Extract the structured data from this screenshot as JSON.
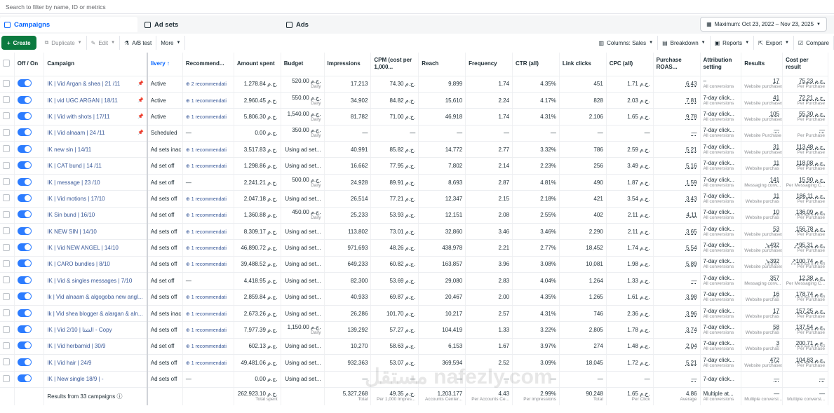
{
  "search": {
    "placeholder": "Search to filter by name, ID or metrics"
  },
  "tabs": {
    "campaigns": "Campaigns",
    "adsets": "Ad sets",
    "ads": "Ads"
  },
  "date_range": "Maximum: Oct 23, 2022 – Nov 23, 2025",
  "toolbar": {
    "create": "Create",
    "duplicate": "Duplicate",
    "edit": "Edit",
    "abtest": "A/B test",
    "more": "More",
    "columns": "Columns: Sales",
    "breakdown": "Breakdown",
    "reports": "Reports",
    "export": "Export",
    "compare": "Compare"
  },
  "headers": {
    "offon": "Off / On",
    "campaign": "Campaign",
    "delivery": "livery ↑",
    "recommendations": "Recommend...",
    "amount": "Amount spent",
    "budget": "Budget",
    "impressions": "Impressions",
    "cpm": "CPM (cost per 1,000...",
    "reach": "Reach",
    "frequency": "Frequency",
    "ctr": "CTR (all)",
    "linkclicks": "Link clicks",
    "cpc": "CPC (all)",
    "roas": "Purchase ROAS...",
    "attribution": "Attribution setting",
    "results": "Results",
    "cost": "Cost per result"
  },
  "rows": [
    {
      "name": "IK | Vid Argan & shea | 21 /11",
      "pin": true,
      "delivery": "Active",
      "reco": "2 recommendati",
      "amount": "1,278.84 ج.م.",
      "budget": "520.00 ج.م.",
      "budget_sub": "Daily",
      "impr": "17,213",
      "cpm": "74.30 ج.م.",
      "reach": "9,899",
      "freq": "1.74",
      "ctr": "4.35%",
      "clicks": "451",
      "cpc": "1.71 ج.م.",
      "roas": "6.43",
      "attr": "–",
      "attr_sub": "All conversions",
      "res": "17",
      "res_sub": "Website purchases",
      "cost": "75.23 ج.م.",
      "cost_sub": "Per Purchase"
    },
    {
      "name": "IK | vid UGC ARGAN | 18/11",
      "pin": true,
      "delivery": "Active",
      "reco": "1 recommendati",
      "amount": "2,960.45 ج.م.",
      "budget": "550.00 ج.م.",
      "budget_sub": "Daily",
      "impr": "34,902",
      "cpm": "84.82 ج.م.",
      "reach": "15,610",
      "freq": "2.24",
      "ctr": "4.17%",
      "clicks": "828",
      "cpc": "2.03 ج.م.",
      "roas": "7.81",
      "attr": "7-day click...",
      "attr_sub": "All conversions",
      "res": "41",
      "res_sub": "Website purchases",
      "cost": "72.21 ج.م.",
      "cost_sub": "Per Purchase"
    },
    {
      "name": "IK | Vid with shots | 17/11",
      "pin": true,
      "delivery": "Active",
      "reco": "1 recommendati",
      "amount": "5,806.30 ج.م.",
      "budget": "1,540.00 ج.م.",
      "budget_sub": "Daily",
      "impr": "81,782",
      "cpm": "71.00 ج.م.",
      "reach": "46,918",
      "freq": "1.74",
      "ctr": "4.31%",
      "clicks": "2,106",
      "cpc": "1.65 ج.م.",
      "roas": "9.78",
      "attr": "7-day click...",
      "attr_sub": "All conversions",
      "res": "105",
      "res_sub": "Website purchases",
      "cost": "55.30 ج.م.",
      "cost_sub": "Per Purchase"
    },
    {
      "name": "IK | Vid alnaam | 24 /11",
      "pin": true,
      "delivery": "Scheduled",
      "reco": "—",
      "amount": "0.00 ج.م.",
      "budget": "350.00 ج.م.",
      "budget_sub": "Daily",
      "impr": "—",
      "cpm": "—",
      "reach": "—",
      "freq": "—",
      "ctr": "—",
      "clicks": "—",
      "cpc": "—",
      "roas": "—",
      "attr": "7-day click...",
      "attr_sub": "All conversions",
      "res": "—",
      "res_sub": "Website Purchase",
      "cost": "—",
      "cost_sub": "Per Purchase"
    },
    {
      "name": "IK new sin | 14/11",
      "pin": false,
      "delivery": "Ad sets inac",
      "reco": "1 recommendati",
      "amount": "3,517.83 ج.م.",
      "budget": "Using ad set...",
      "budget_sub": "",
      "impr": "40,991",
      "cpm": "85.82 ج.م.",
      "reach": "14,772",
      "freq": "2.77",
      "ctr": "3.32%",
      "clicks": "786",
      "cpc": "2.59 ج.م.",
      "roas": "5.21",
      "attr": "7-day click...",
      "attr_sub": "All conversions",
      "res": "31",
      "res_sub": "Website purchases",
      "cost": "113.48 ج.م.",
      "cost_sub": "Per Purchase"
    },
    {
      "name": "IK | CAT bund | 14 /11",
      "pin": false,
      "delivery": "Ad set off",
      "reco": "1 recommendati",
      "amount": "1,298.86 ج.م.",
      "budget": "Using ad set...",
      "budget_sub": "",
      "impr": "16,662",
      "cpm": "77.95 ج.م.",
      "reach": "7,802",
      "freq": "2.14",
      "ctr": "2.23%",
      "clicks": "256",
      "cpc": "3.49 ج.م.",
      "roas": "5.16",
      "attr": "7-day click...",
      "attr_sub": "All conversions",
      "res": "11",
      "res_sub": "Website purchas",
      "cost": "118.08 ج.م.",
      "cost_sub": "Per Purchase"
    },
    {
      "name": "IK | message | 23 /10",
      "pin": false,
      "delivery": "Ad set off",
      "reco": "—",
      "amount": "2,241.21 ج.م.",
      "budget": "500.00 ج.م.",
      "budget_sub": "Daily",
      "impr": "24,928",
      "cpm": "89.91 ج.م.",
      "reach": "8,693",
      "freq": "2.87",
      "ctr": "4.81%",
      "clicks": "490",
      "cpc": "1.87 ج.م.",
      "roas": "1.59",
      "attr": "7-day click...",
      "attr_sub": "All conversions",
      "res": "141",
      "res_sub": "Messaging conv...",
      "cost": "15.90 ج.م.",
      "cost_sub": "Per Messaging C..."
    },
    {
      "name": "IK | Vid motions | 17/10",
      "pin": false,
      "delivery": "Ad sets off",
      "reco": "1 recommendati",
      "amount": "2,047.18 ج.م.",
      "budget": "Using ad set...",
      "budget_sub": "",
      "impr": "26,514",
      "cpm": "77.21 ج.م.",
      "reach": "12,347",
      "freq": "2.15",
      "ctr": "2.18%",
      "clicks": "421",
      "cpc": "3.54 ج.م.",
      "roas": "3.43",
      "attr": "7-day click...",
      "attr_sub": "All conversions",
      "res": "11",
      "res_sub": "Website purchas",
      "cost": "186.11 ج.م.",
      "cost_sub": "Per Purchase"
    },
    {
      "name": "IK Sin bund | 16/10",
      "pin": false,
      "delivery": "Ad set off",
      "reco": "1 recommendati",
      "amount": "1,360.88 ج.م.",
      "budget": "450.00 ج.م.",
      "budget_sub": "Daily",
      "impr": "25,233",
      "cpm": "53.93 ج.م.",
      "reach": "12,151",
      "freq": "2.08",
      "ctr": "2.55%",
      "clicks": "402",
      "cpc": "2.11 ج.م.",
      "roas": "4.11",
      "attr": "7-day click...",
      "attr_sub": "All conversions",
      "res": "10",
      "res_sub": "Website purchas",
      "cost": "136.09 ج.م.",
      "cost_sub": "Per Purchase"
    },
    {
      "name": "IK NEW SIN | 14/10",
      "pin": false,
      "delivery": "Ad sets off",
      "reco": "1 recommendati",
      "amount": "8,309.17 ج.م.",
      "budget": "Using ad set...",
      "budget_sub": "",
      "impr": "113,802",
      "cpm": "73.01 ج.م.",
      "reach": "32,860",
      "freq": "3.46",
      "ctr": "3.46%",
      "clicks": "2,290",
      "cpc": "2.11 ج.م.",
      "roas": "3.65",
      "attr": "7-day click...",
      "attr_sub": "All conversions",
      "res": "53",
      "res_sub": "Website purchases",
      "cost": "156.78 ج.م.",
      "cost_sub": "Per Purchase"
    },
    {
      "name": "IK | Vid NEW ANGEL | 14/10",
      "pin": false,
      "delivery": "Ad sets off",
      "reco": "1 recommendati",
      "amount": "46,890.72 ج.م.",
      "budget": "Using ad set...",
      "budget_sub": "",
      "impr": "971,693",
      "cpm": "48.26 ج.م.",
      "reach": "438,978",
      "freq": "2.21",
      "ctr": "2.77%",
      "clicks": "18,452",
      "cpc": "1.74 ج.م.",
      "roas": "5.54",
      "attr": "7-day click...",
      "attr_sub": "All conversions",
      "res": "↘492",
      "res_sub": "Website purchases",
      "cost": "↗95.31 ج.م.",
      "cost_sub": "Per Purchase"
    },
    {
      "name": "IK | CARO bundles | 8/10",
      "pin": false,
      "delivery": "Ad sets off",
      "reco": "1 recommendati",
      "amount": "39,488.52 ج.م.",
      "budget": "Using ad set...",
      "budget_sub": "",
      "impr": "649,233",
      "cpm": "60.82 ج.م.",
      "reach": "163,857",
      "freq": "3.96",
      "ctr": "3.08%",
      "clicks": "10,081",
      "cpc": "1.98 ج.م.",
      "roas": "5.89",
      "attr": "7-day click...",
      "attr_sub": "All conversions",
      "res": "↘392",
      "res_sub": "Website purchases",
      "cost": "↗100.74 ج.م.",
      "cost_sub": "Per Purchase"
    },
    {
      "name": "IK | Vid & singles messages | 7/10",
      "pin": false,
      "delivery": "Ad set off",
      "reco": "—",
      "amount": "4,418.95 ج.م.",
      "budget": "Using ad set...",
      "budget_sub": "",
      "impr": "82,300",
      "cpm": "53.69 ج.م.",
      "reach": "29,080",
      "freq": "2.83",
      "ctr": "4.04%",
      "clicks": "1,264",
      "cpc": "1.33 ج.م.",
      "roas": "—",
      "attr": "7-day click...",
      "attr_sub": "All conversions",
      "res": "357",
      "res_sub": "Messaging conv...",
      "cost": "12.38 ج.م.",
      "cost_sub": "Per Messaging C..."
    },
    {
      "name": "Ik | Vid alnaam & algogoba new angl...",
      "pin": false,
      "delivery": "Ad sets off",
      "reco": "1 recommendati",
      "amount": "2,859.84 ج.م.",
      "budget": "Using ad set...",
      "budget_sub": "",
      "impr": "40,933",
      "cpm": "69.87 ج.م.",
      "reach": "20,467",
      "freq": "2.00",
      "ctr": "4.35%",
      "clicks": "1,265",
      "cpc": "1.61 ج.م.",
      "roas": "3.98",
      "attr": "7-day click...",
      "attr_sub": "All conversions",
      "res": "16",
      "res_sub": "Website purchas",
      "cost": "178.74 ج.م.",
      "cost_sub": "Per Purchase"
    },
    {
      "name": "Ik | Vid shea blogger & alargan & aln...",
      "pin": false,
      "delivery": "Ad sets inac",
      "reco": "1 recommendati",
      "amount": "2,673.26 ج.م.",
      "budget": "Using ad set...",
      "budget_sub": "",
      "impr": "26,286",
      "cpm": "101.70 ج.م.",
      "reach": "10,217",
      "freq": "2.57",
      "ctr": "4.31%",
      "clicks": "746",
      "cpc": "2.36 ج.م.",
      "roas": "3.96",
      "attr": "7-day click...",
      "attr_sub": "All conversions",
      "res": "17",
      "res_sub": "Website purchas",
      "cost": "157.25 ج.م.",
      "cost_sub": "Per Purchase"
    },
    {
      "name": "IK | Vid 2/10 | الشتا - Copy",
      "pin": false,
      "delivery": "Ad sets off",
      "reco": "1 recommendati",
      "amount": "7,977.39 ج.م.",
      "budget": "1,150.00 ج.م.",
      "budget_sub": "Daily",
      "impr": "139,292",
      "cpm": "57.27 ج.م.",
      "reach": "104,419",
      "freq": "1.33",
      "ctr": "3.22%",
      "clicks": "2,805",
      "cpc": "1.78 ج.م.",
      "roas": "3.74",
      "attr": "7-day click...",
      "attr_sub": "All conversions",
      "res": "58",
      "res_sub": "Website purchas",
      "cost": "137.54 ج.م.",
      "cost_sub": "Per Purchase"
    },
    {
      "name": "IK | Vid herbamid | 30/9",
      "pin": false,
      "delivery": "Ad set off",
      "reco": "1 recommendati",
      "amount": "602.13 ج.م.",
      "budget": "Using ad set...",
      "budget_sub": "",
      "impr": "10,270",
      "cpm": "58.63 ج.م.",
      "reach": "6,153",
      "freq": "1.67",
      "ctr": "3.97%",
      "clicks": "274",
      "cpc": "1.48 ج.م.",
      "roas": "2.04",
      "attr": "7-day click...",
      "attr_sub": "All conversions",
      "res": "3",
      "res_sub": "Website purchas",
      "cost": "200.71 ج.م.",
      "cost_sub": "Per Purchase"
    },
    {
      "name": "IK | Vid hair | 24/9",
      "pin": false,
      "delivery": "Ad sets off",
      "reco": "1 recommendati",
      "amount": "49,481.06 ج.م.",
      "budget": "Using ad set...",
      "budget_sub": "",
      "impr": "932,363",
      "cpm": "53.07 ج.م.",
      "reach": "369,594",
      "freq": "2.52",
      "ctr": "3.09%",
      "clicks": "18,045",
      "cpc": "1.72 ج.م.",
      "roas": "5.21",
      "attr": "7-day click...",
      "attr_sub": "All conversions",
      "res": "472",
      "res_sub": "Website purchases",
      "cost": "104.83 ج.م.",
      "cost_sub": "Per Purchase"
    },
    {
      "name": "IK | New single 18/9 | -",
      "pin": false,
      "delivery": "Ad sets off",
      "reco": "—",
      "amount": "0.00 ج.م.",
      "budget": "Using ad set...",
      "budget_sub": "",
      "impr": "—",
      "cpm": "—",
      "reach": "—",
      "freq": "—",
      "ctr": "—",
      "clicks": "—",
      "cpc": "—",
      "roas": "—",
      "attr": "7-day click...",
      "attr_sub": "",
      "res": "—",
      "res_sub": "",
      "cost": "—",
      "cost_sub": ""
    }
  ],
  "footer": {
    "label": "Results from 33 campaigns",
    "amount": "262,923.10 ج.م.",
    "amount_sub": "Total spent",
    "impr": "5,327,268",
    "impr_sub": "Total",
    "cpm": "49.35 ج.م.",
    "cpm_sub": "Per 1,000 Impres...",
    "reach": "1,203,177",
    "reach_sub": "Accounts Center...",
    "freq": "4.43",
    "freq_sub": "Per Accounts Ce...",
    "ctr": "2.99%",
    "ctr_sub": "Per impressions",
    "clicks": "90,248",
    "clicks_sub": "Total",
    "cpc": "1.65 ج.م.",
    "cpc_sub": "Per Click",
    "roas": "4.86",
    "roas_sub": "Average",
    "attr": "Multiple at...",
    "attr_sub": "All conversions",
    "res": "—",
    "res_sub": "Multiple conversi...",
    "cost": "—",
    "cost_sub": "Multiple conversi..."
  },
  "watermark": "مستقل\nnafezly.com",
  "colors": {
    "accent": "#0866ff",
    "create": "#0b7a3f",
    "link": "#385898"
  }
}
